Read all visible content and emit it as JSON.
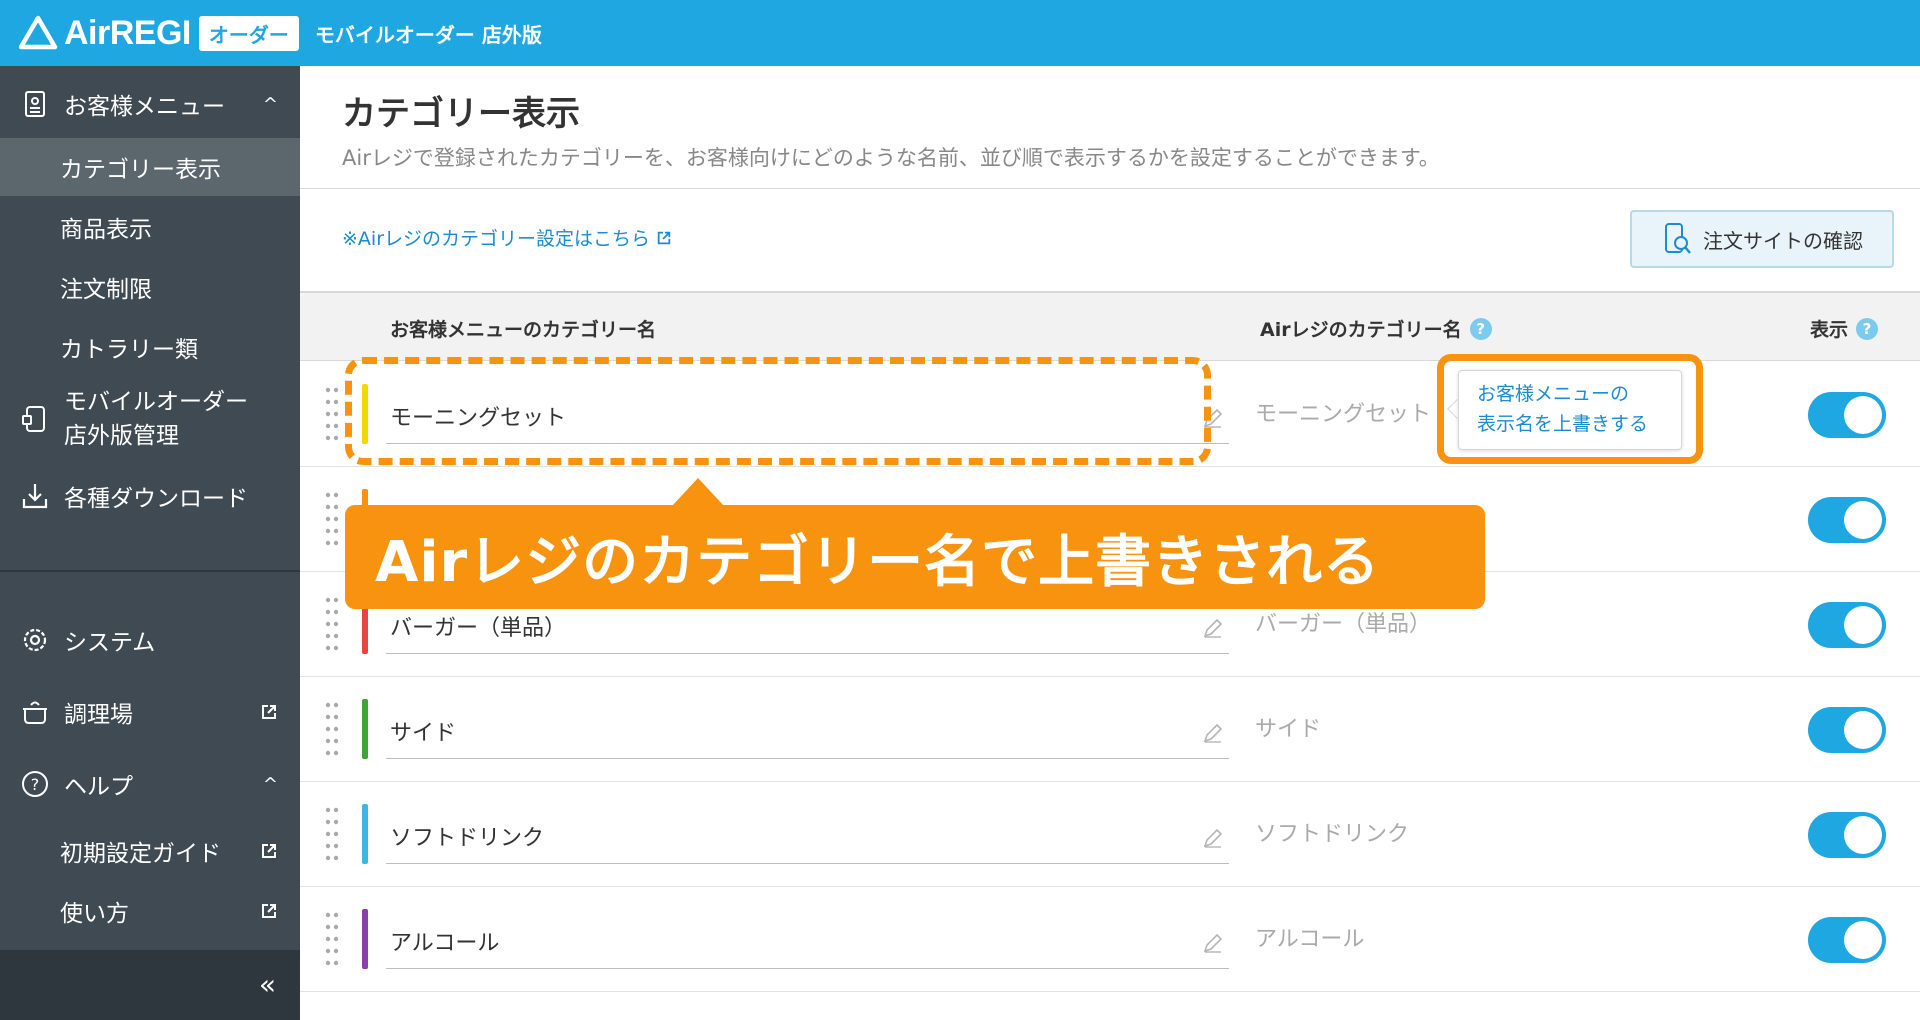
{
  "header": {
    "logo_text": "AirREGI",
    "logo_badge": "オーダー",
    "app_title": "モバイルオーダー 店外版"
  },
  "sidebar": {
    "customer_menu": "お客様メニュー",
    "sub_items": [
      "カテゴリー表示",
      "商品表示",
      "注文制限",
      "カトラリー類"
    ],
    "mobile_order_line1": "モバイルオーダー",
    "mobile_order_line2": "店外版管理",
    "downloads": "各種ダウンロード",
    "system": "システム",
    "kitchen": "調理場",
    "help": "ヘルプ",
    "help_items": [
      "初期設定ガイド",
      "使い方"
    ],
    "collapse": "«"
  },
  "main": {
    "title": "カテゴリー表示",
    "description": "Airレジで登録されたカテゴリーを、お客様向けにどのような名前、並び順で表示するかを設定することができます。",
    "link_note": "※Airレジのカテゴリー設定はこちら",
    "confirm_button": "注文サイトの確認",
    "columns": {
      "customer_name": "お客様メニューのカテゴリー名",
      "air_name": "Airレジのカテゴリー名",
      "display": "表示"
    },
    "rows": [
      {
        "name": "モーニングセット",
        "air_name": "モーニングセット",
        "color": "#f5d700",
        "visible": true
      },
      {
        "name": "",
        "air_name": "",
        "color": "#f7930f",
        "visible": true
      },
      {
        "name": "バーガー（単品）",
        "air_name": "バーガー（単品）",
        "color": "#e8453c",
        "visible": true
      },
      {
        "name": "サイド",
        "air_name": "サイド",
        "color": "#3fa535",
        "visible": true
      },
      {
        "name": "ソフトドリンク",
        "air_name": "ソフトドリンク",
        "color": "#3fb6e2",
        "visible": true
      },
      {
        "name": "アルコール",
        "air_name": "アルコール",
        "color": "#8e3fa6",
        "visible": true
      }
    ]
  },
  "tooltip": {
    "line1": "お客様メニューの",
    "line2": "表示名を上書きする"
  },
  "callout": {
    "text": "Airレジのカテゴリー名で上書きされる"
  },
  "colors": {
    "brand": "#1ea7e0",
    "sidebar": "#3f4a52",
    "annotation": "#f7930f"
  }
}
